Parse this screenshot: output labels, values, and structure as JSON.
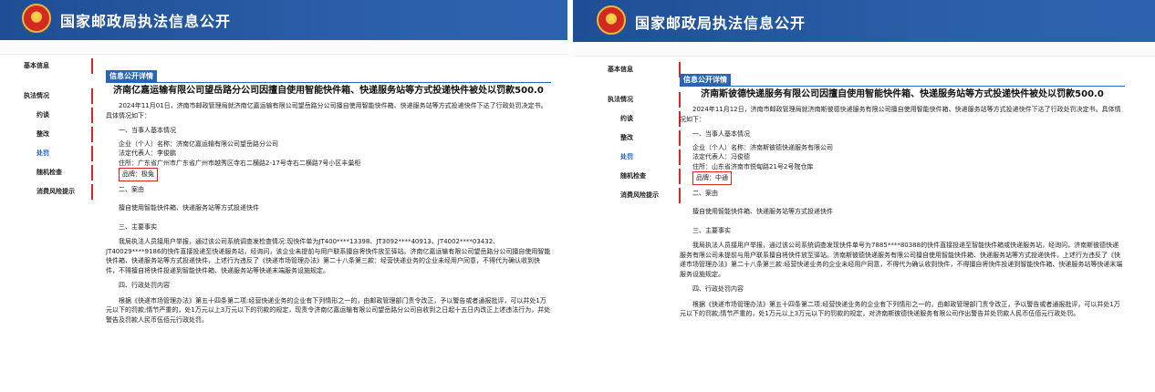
{
  "site_title": "国家邮政局执法信息公开",
  "colors": {
    "header_bg": "#2a5ea8",
    "accent_red": "#d8262c",
    "tab_blue": "#2a64b6",
    "active_link": "#1a5cc8"
  },
  "sidebar": {
    "items": [
      {
        "label": "基本信息"
      },
      {
        "label": "执法情况"
      },
      {
        "label": "约谈"
      },
      {
        "label": "整改"
      },
      {
        "label": "处罚"
      },
      {
        "label": "随机检查"
      },
      {
        "label": "消费风险提示"
      }
    ]
  },
  "tab_label": "信息公开详情",
  "section_headings": {
    "s1": "一、当事人基本情况",
    "s2": "二、案由",
    "s3": "三、主要事实",
    "s4": "四、行政处罚内容"
  },
  "left": {
    "title": "济南亿嘉运输有限公司望岳路分公司因擅自使用智能快件箱、快递服务站等方式投递快件被处以罚款500.0",
    "intro": "2024年11月01日，济南市邮政管理局就济南亿嘉运输有限公司望岳路分公司擅自使用智能快件箱、快递服务站等方式投递快件下达了行政处罚决定书。具体情况如下：",
    "company": "企业（个人）名称：济南亿嘉运输有限公司望岳路分公司",
    "legal_rep": "法定代表人：李俊鹏",
    "address": "住所：广东省广州市广东省广州市越秀区寺右二横路2-17号寺右二横路7号小区丰巢柜",
    "brand": "品牌：极兔",
    "cause": "擅自使用智能快件箱、快递服务站等方式投递快件",
    "facts": "我局执法人员接用户举报，通过该公司系统调查发检查情况:现快件单为JT400****13398、JT3092****40913、JT4002****03432、JT40029****9186的快件直接投递至快递服务站，经询问，该企业未提前与用户联系擅自将快件放至驿站。济南亿嘉运输有限公司望岳路分公司擅自使用智能快件箱、快递服务站等方式投递快件，上述行为违反了《快递市场管理办法》第二十八条第三款：经营快递业务的企业未经用户同意，不得代为确认收到快件，不得擅自将快件投递到智能快件箱、快递服务站等快递末端服务设施规定。",
    "penalty": "根据《快递市场管理办法》第五十四条第二项:经营快递业务的企业有下列情形之一的，由邮政管理部门责令改正，予以警告或者通报批评，可以并处1万元以下的罚款;情节严重的，处1万元以上3万元以下的罚款的规定，现责令济南亿嘉运输有限公司望岳路分公司自收到之日起十五日内改正上述违法行为，并处警告及罚款人民币伍佰元行政处罚。"
  },
  "right": {
    "title": "济南斯彼德快递服务有限公司因擅自使用智能快件箱、快递服务站等方式投递快件被处以罚款500.0",
    "intro": "2024年11月12日，济南市邮政管理局就济南斯彼德快递服务有限公司擅自使用智能快件箱、快递服务站等方式投递快件下达了行政处罚决定书。具体情况如下：",
    "company": "企业（个人）名称：济南斯彼德快递服务有限公司",
    "legal_rep": "法定代表人：冯俊德",
    "address": "住所：山东省济南市悦甸路21号2号院仓库",
    "brand": "品牌：中通",
    "cause": "擅自使用智能快件箱、快递服务站等方式投递快件",
    "facts": "我局执法人员接用户举报，通过该公司系统调查发现快件单号为7885****80388的快件直接投递至智能快件箱或快递服务站，经询问，济南斯彼德快递服务有限公司未提前与用户联系擅自将快件放至驿站。济南斯彼德快递服务有限公司擅自使用智能快件箱、快递服务站等方式投递快件，上述行为违反了《快递市场管理办法》第二十八条第三款:经营快递业务的企业未经用户同意，不得代为确认收到快件，不得擅自将快件投递到智能快件箱、快递服务站等快递末端服务设施规定。",
    "penalty": "根据《快递市场管理办法》第五十四条第二项:经营快递业务的企业有下列情形之一的，由邮政管理部门责令改正，予以警告或者通报批评，可以并处1万元以下的罚款;情节严重的，处1万元以上3万元以下的罚款的规定，对济南斯彼德快递服务有限公司作出警告并处罚款人民币伍佰元行政处罚。"
  }
}
